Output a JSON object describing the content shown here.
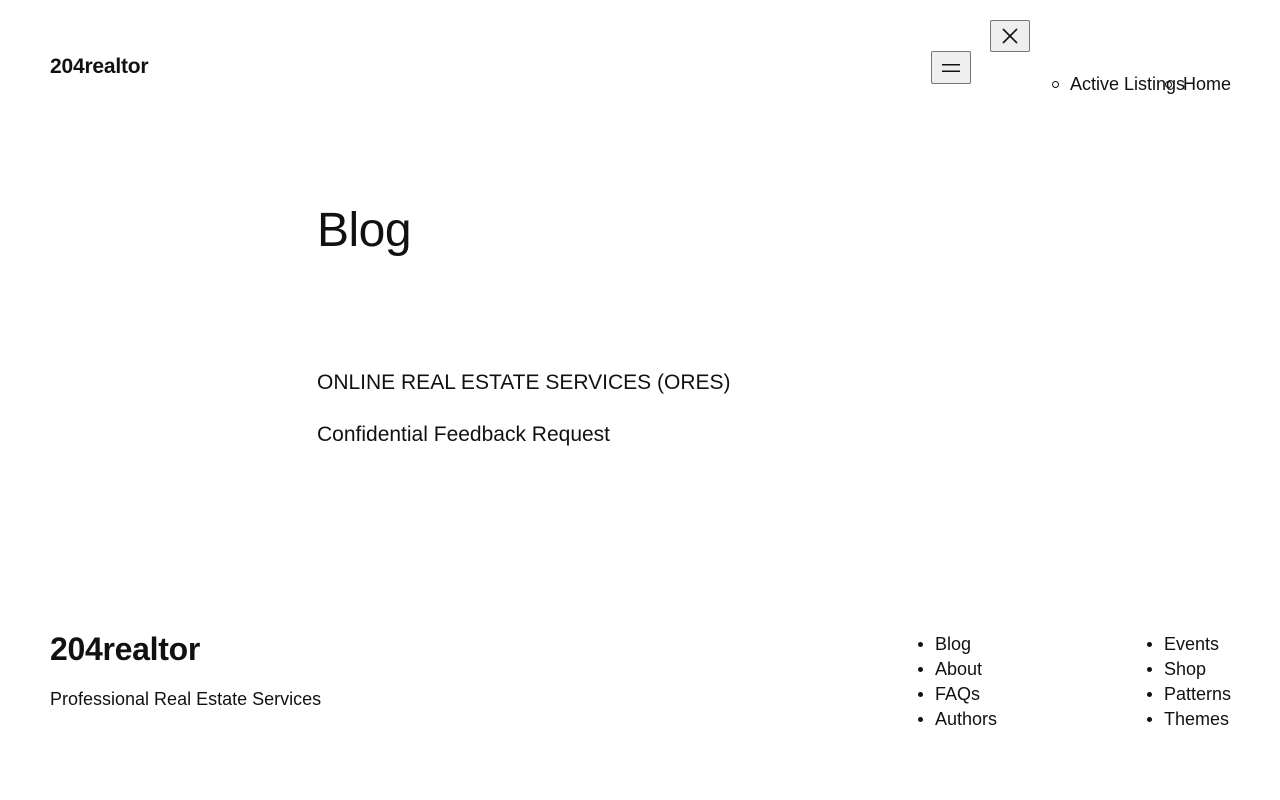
{
  "header": {
    "site_title": "204realtor",
    "nav": {
      "items": [
        "Active Listings",
        "Home"
      ]
    },
    "icons": {
      "menu": "hamburger-menu-icon",
      "close": "close-icon"
    }
  },
  "main": {
    "title": "Blog",
    "posts": [
      "ONLINE REAL ESTATE SERVICES (ORES)",
      "Confidential Feedback Request"
    ]
  },
  "footer": {
    "site_title": "204realtor",
    "tagline": "Professional Real Estate Services",
    "menu_1": [
      "Blog",
      "About",
      "FAQs",
      "Authors"
    ],
    "menu_2": [
      "Events",
      "Shop",
      "Patterns",
      "Themes"
    ]
  }
}
